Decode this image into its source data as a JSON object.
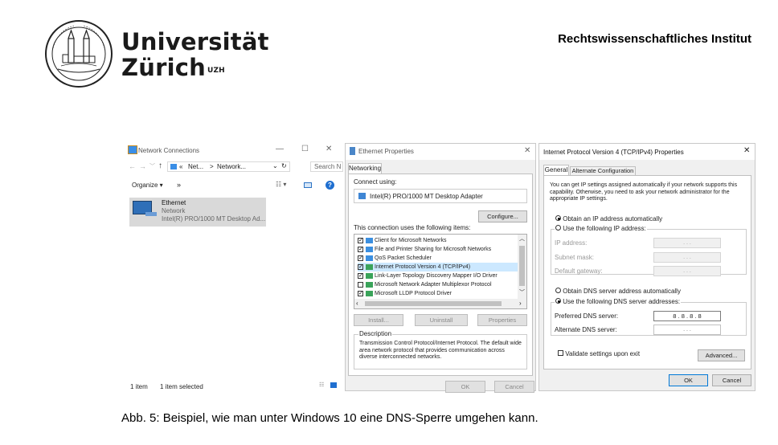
{
  "header": {
    "university_line1": "Universität",
    "university_line2": "Zürich",
    "university_sup": "UZH",
    "institute": "Rechtswissenschaftliches Institut"
  },
  "caption": "Abb. 5: Beispiel, wie man unter Windows 10 eine DNS-Sperre umgehen kann.",
  "explorer": {
    "title": "Network Connections",
    "breadcrumb": [
      "«",
      "Net...",
      ">",
      "Network..."
    ],
    "search_placeholder": "Search N",
    "organize": "Organize ▾",
    "more": "»",
    "item": {
      "name": "Ethernet",
      "type": "Network",
      "adapter": "Intel(R) PRO/1000 MT Desktop Ad..."
    },
    "status_count": "1 item",
    "status_selected": "1 item selected"
  },
  "props": {
    "title": "Ethernet Properties",
    "tab": "Networking",
    "connect_using_label": "Connect using:",
    "adapter": "Intel(R) PRO/1000 MT Desktop Adapter",
    "configure": "Configure...",
    "items_label": "This connection uses the following items:",
    "items": [
      {
        "label": "Client for Microsoft Networks",
        "checked": true
      },
      {
        "label": "File and Printer Sharing for Microsoft Networks",
        "checked": true
      },
      {
        "label": "QoS Packet Scheduler",
        "checked": true
      },
      {
        "label": "Internet Protocol Version 4 (TCP/IPv4)",
        "checked": true,
        "selected": true
      },
      {
        "label": "Link-Layer Topology Discovery Mapper I/O Driver",
        "checked": true
      },
      {
        "label": "Microsoft Network Adapter Multiplexor Protocol",
        "checked": false
      },
      {
        "label": "Microsoft LLDP Protocol Driver",
        "checked": true
      }
    ],
    "install": "Install...",
    "uninstall": "Uninstall",
    "properties": "Properties",
    "description_label": "Description",
    "description": "Transmission Control Protocol/Internet Protocol. The default wide area network protocol that provides communication across diverse interconnected networks.",
    "ok": "OK",
    "cancel": "Cancel"
  },
  "ipv4": {
    "title": "Internet Protocol Version 4 (TCP/IPv4) Properties",
    "tab_general": "General",
    "tab_alt": "Alternate Configuration",
    "intro": "You can get IP settings assigned automatically if your network supports this capability. Otherwise, you need to ask your network administrator for the appropriate IP settings.",
    "auto_ip": "Obtain an IP address automatically",
    "use_ip": "Use the following IP address:",
    "ip_label": "IP address:",
    "mask_label": "Subnet mask:",
    "gateway_label": "Default gateway:",
    "empty_ip": ".     .     .",
    "auto_dns": "Obtain DNS server address automatically",
    "use_dns": "Use the following DNS server addresses:",
    "pref_label": "Preferred DNS server:",
    "pref_value": "8 . 8 . 8 . 8",
    "alt_label": "Alternate DNS server:",
    "alt_value": ".     .     .",
    "validate": "Validate settings upon exit",
    "advanced": "Advanced...",
    "ok": "OK",
    "cancel": "Cancel"
  }
}
